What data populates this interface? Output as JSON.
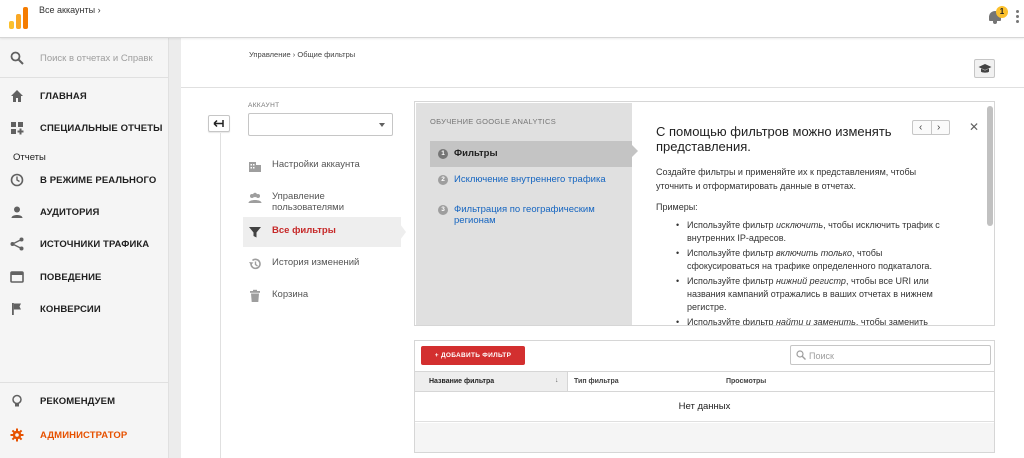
{
  "topbar": {
    "accounts_label": "Все аккаунты",
    "accounts_chevron": "›",
    "notification_count": "1",
    "brand_colors": [
      "#fbc02d",
      "#f9a825",
      "#f57c00"
    ]
  },
  "sidebar": {
    "search_placeholder": "Поиск в отчетах и Справк",
    "items_top": [
      {
        "label": "ГЛАВНАЯ",
        "icon": "home-icon"
      },
      {
        "label": "СПЕЦИАЛЬНЫЕ ОТЧЕТЫ",
        "icon": "dashboard-icon"
      }
    ],
    "reports_section": "Отчеты",
    "items_reports": [
      {
        "label": "В РЕЖИМЕ РЕАЛЬНОГО",
        "icon": "clock-icon"
      },
      {
        "label": "АУДИТОРИЯ",
        "icon": "person-icon"
      },
      {
        "label": "ИСТОЧНИКИ ТРАФИКА",
        "icon": "acquisition-icon"
      },
      {
        "label": "ПОВЕДЕНИЕ",
        "icon": "behavior-icon"
      },
      {
        "label": "КОНВЕРСИИ",
        "icon": "flag-icon"
      }
    ],
    "items_bottom": [
      {
        "label": "РЕКОМЕНДУЕМ",
        "icon": "lightbulb-icon"
      },
      {
        "label": "АДМИНИСТРАТОР",
        "icon": "gear-icon"
      }
    ],
    "admin_color": "#e65100"
  },
  "main": {
    "breadcrumb": "Управление › Общие фильтры",
    "account_label": "АККАУНТ",
    "account_value": "",
    "menu": [
      {
        "label": "Настройки аккаунта",
        "icon": "building-icon"
      },
      {
        "label": "Управление пользователями",
        "icon": "people-icon"
      },
      {
        "label": "Все фильтры",
        "icon": "filter-icon"
      },
      {
        "label": "История изменений",
        "icon": "history-icon"
      },
      {
        "label": "Корзина",
        "icon": "trash-icon"
      }
    ],
    "active_color": "#c62828"
  },
  "tutorial": {
    "header": "ОБУЧЕНИЕ GOOGLE ANALYTICS",
    "steps": [
      {
        "num": "1",
        "label": "Фильтры"
      },
      {
        "num": "2",
        "label": "Исключение внутреннего трафика"
      },
      {
        "num": "3",
        "label": "Фильтрация по географическим регионам"
      }
    ],
    "title": "С помощью фильтров можно изменять представления.",
    "intro": "Создайте фильтры и применяйте их к представлениям, чтобы уточнить и отформатировать данные в отчетах.",
    "examples_label": "Примеры:",
    "bullets": [
      {
        "pre": "Используйте фильтр ",
        "em": "исключить",
        "post": ", чтобы исключить трафик с внутренних IP-адресов."
      },
      {
        "pre": "Используйте фильтр ",
        "em": "включить только",
        "post": ", чтобы сфокусироваться на трафике определенного подкаталога."
      },
      {
        "pre": "Используйте фильтр ",
        "em": "нижний регистр",
        "post": ", чтобы все URI или названия кампаний отражались в ваших отчетах в нижнем регистре."
      },
      {
        "pre": "Используйте фильтр ",
        "em": "найти и заменить",
        "post": ", чтобы заменить"
      }
    ],
    "prev": "‹",
    "next": "›",
    "close": "✕"
  },
  "filters": {
    "add_button": "+ ДОБАВИТЬ ФИЛЬТР",
    "add_button_color": "#d32f2f",
    "search_placeholder": "Поиск",
    "columns": [
      "Название фильтра",
      "Тип фильтра",
      "Просмотры"
    ],
    "sort_indicator": "↓",
    "empty": "Нет данных"
  }
}
